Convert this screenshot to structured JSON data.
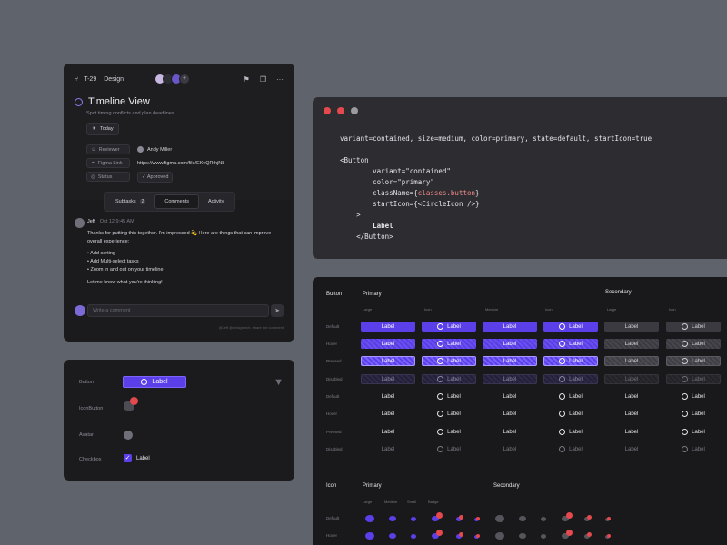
{
  "task": {
    "id": "T-29",
    "project": "Design",
    "avatars_more": "+",
    "title": "Timeline View",
    "subtitle": "Spot timing conflicts and plan deadlines",
    "date_chip": "Today",
    "props": [
      {
        "key": "Reviewer",
        "value": "Andy Miller"
      },
      {
        "key": "Figma Link",
        "value": "https://www.figma.com/file/EKvQRthjN8"
      },
      {
        "key": "Status",
        "value": "Approved"
      }
    ],
    "tabs": [
      {
        "label": "Subtasks",
        "badge": "2"
      },
      {
        "label": "Comments"
      },
      {
        "label": "Activity"
      }
    ],
    "comment": {
      "author": "Jeff",
      "time": "Oct 12 9:45 AM",
      "intro": "Thanks for putting this together. I'm impressed 💫 Here are things that can improve overall experience:",
      "items": [
        "• Add sorting",
        "• Add Multi-select tasks",
        "• Zoom in and out on your timeline"
      ],
      "outro": "Let me know what you're thinking!"
    },
    "reply_placeholder": "Write a comment",
    "hint": "@Jeff @designtech: share the comment"
  },
  "components": {
    "rows": [
      "Button",
      "IconButton",
      "Avatar",
      "Checkbox"
    ],
    "button_label": "Label",
    "checkbox_label": "Label"
  },
  "code": {
    "line1": "variant=contained, size=medium, color=primary, state=default, startIcon=true",
    "open_tag": "<Button",
    "attr_variant": "variant=\"contained\"",
    "attr_color": "color=\"primary\"",
    "attr_class_key": "className={",
    "attr_class_expr": "classes.button",
    "attr_class_end": "}",
    "attr_icon": "startIcon={<CircleIcon />}",
    "close_bracket": ">",
    "label": "Label",
    "close_tag": "</Button>"
  },
  "matrix": {
    "button_title": "Button",
    "primary_title": "Primary",
    "secondary_title": "Secondary",
    "col_labels": [
      "Large",
      "Icon",
      "Medium",
      "Icon",
      "Large",
      "Icon"
    ],
    "row_labels": [
      "Default",
      "Hover",
      "Pressed",
      "Disabled",
      "Default",
      "Hover",
      "Pressed",
      "Disabled"
    ],
    "label": "Label",
    "icon_title": "Icon",
    "icon_primary": "Primary",
    "icon_secondary": "Secondary",
    "icon_cols": [
      "Large",
      "Medium",
      "Small",
      "Badge"
    ],
    "icon_rows": [
      "Default",
      "Hover"
    ]
  },
  "colors": {
    "accent": "#5b3fe8",
    "badge": "#e5484d",
    "window_close": "#e5484d",
    "window_min": "#e5484d",
    "window_max": "#9a9aa0"
  }
}
